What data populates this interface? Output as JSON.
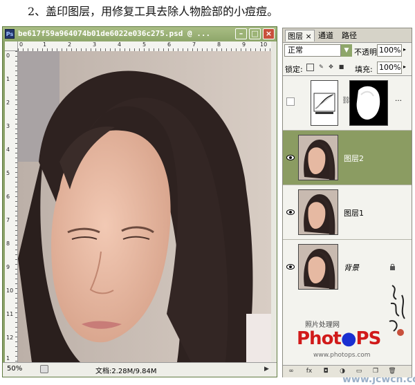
{
  "heading": "2、盖印图层，用修复工具去除人物脸部的小痘痘。",
  "document": {
    "title": "be617f59a964074b01de6022e036c275.psd @ ...",
    "ps_icon": "Ps",
    "ruler_top": [
      "0",
      "1",
      "2",
      "3",
      "4",
      "5",
      "6",
      "7",
      "8",
      "9",
      "10"
    ],
    "ruler_left": [
      "0",
      "1",
      "2",
      "3",
      "4",
      "5",
      "6",
      "7",
      "8",
      "9",
      "10",
      "11",
      "12",
      "1"
    ],
    "zoom": "50%",
    "doc_size": "文档:2.28M/9.84M",
    "buttons": {
      "minimize": "–",
      "maximize": "□",
      "close": "×"
    }
  },
  "layers_panel": {
    "tabs": [
      {
        "label": "图层 ×"
      },
      {
        "label": "通道"
      },
      {
        "label": "路径"
      }
    ],
    "blend_mode": "正常",
    "opacity_label": "不透明度:",
    "opacity_value": "100%",
    "lock_label": "锁定:",
    "fill_label": "填充:",
    "fill_value": "100%",
    "layers": [
      {
        "name": "",
        "type": "adjustment"
      },
      {
        "name": "图层2",
        "selected": true
      },
      {
        "name": "图层1"
      },
      {
        "name": "背景",
        "locked": true
      }
    ]
  },
  "watermark": {
    "caption": "照片处理网",
    "logo_p1": "Phot",
    "logo_p2": "PS",
    "url": "www.photops.com",
    "site": "www.jcwcn.com"
  },
  "colors": {
    "accent": "#8b9c62",
    "title_bar": "#8ea66a",
    "close": "#c8503c"
  }
}
